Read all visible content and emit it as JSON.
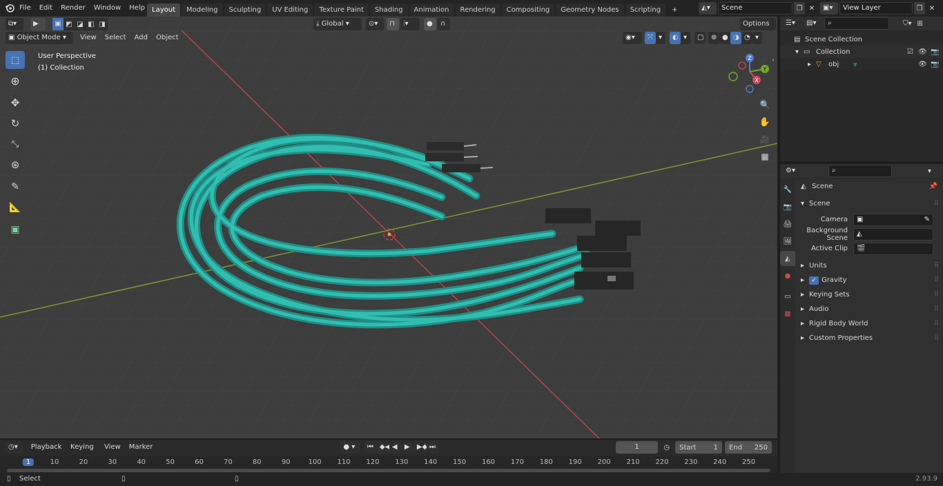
{
  "menubar": {
    "items": [
      "File",
      "Edit",
      "Render",
      "Window",
      "Help"
    ],
    "workspace_tabs": [
      "Layout",
      "Modeling",
      "Sculpting",
      "UV Editing",
      "Texture Paint",
      "Shading",
      "Animation",
      "Rendering",
      "Compositing",
      "Geometry Nodes",
      "Scripting"
    ],
    "add_tab": "+",
    "scene_name": "Scene",
    "view_layer": "View Layer"
  },
  "vp_header": {
    "mode": "Object Mode",
    "menus": [
      "View",
      "Select",
      "Add",
      "Object"
    ],
    "orientation": "Global",
    "options": "Options"
  },
  "overlay": {
    "perspective": "User Perspective",
    "collection": "(1) Collection"
  },
  "gizmo": {
    "z": "Z",
    "y": "Y",
    "x": "X"
  },
  "outliner": {
    "root": "Scene Collection",
    "collection": "Collection",
    "object": "obj"
  },
  "properties": {
    "header": "Scene",
    "panel": "Scene",
    "camera_label": "Camera",
    "bg_scene_label": "Background Scene",
    "active_clip_label": "Active Clip",
    "subpanels": [
      "Units",
      "Gravity",
      "Keying Sets",
      "Audio",
      "Rigid Body World",
      "Custom Properties"
    ]
  },
  "timeline": {
    "menus": [
      "Playback",
      "Keying",
      "View",
      "Marker"
    ],
    "current_frame": "1",
    "start_label": "Start",
    "start_value": "1",
    "end_label": "End",
    "end_value": "250",
    "ruler": [
      "1",
      "10",
      "20",
      "30",
      "40",
      "50",
      "60",
      "70",
      "80",
      "90",
      "100",
      "110",
      "120",
      "130",
      "140",
      "150",
      "160",
      "170",
      "180",
      "190",
      "200",
      "210",
      "220",
      "230",
      "240",
      "250"
    ]
  },
  "status": {
    "left": "Select",
    "version": "2.93.9"
  },
  "colors": {
    "accent": "#4772b3",
    "cable": "#2ec4b6",
    "x_axis": "#c0404a",
    "y_axis": "#7fa02a"
  }
}
